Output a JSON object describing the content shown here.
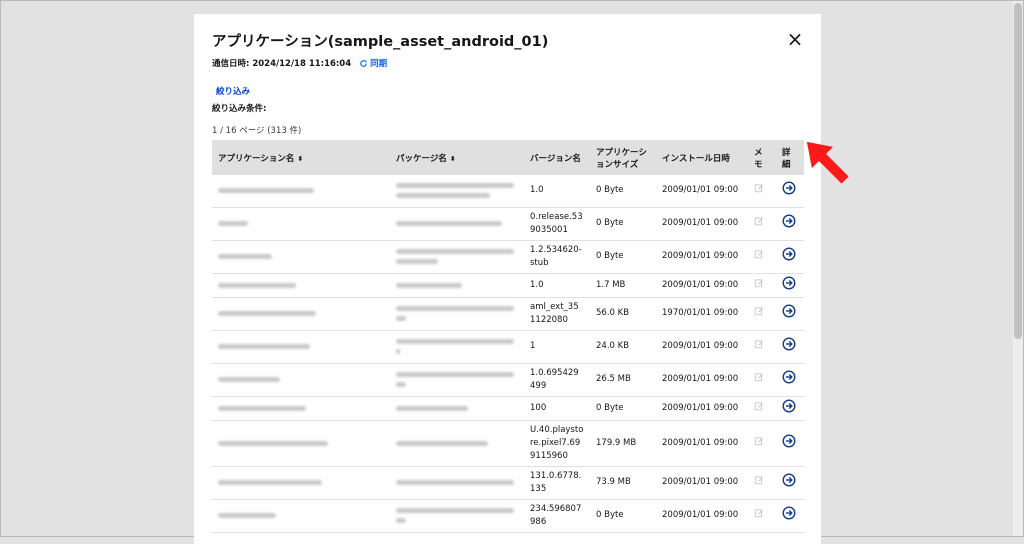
{
  "modal": {
    "title": "アプリケーション(sample_asset_android_01)",
    "close_label": "×",
    "comm_label": "通信日時: 2024/12/18 11:16:04",
    "sync_label": "同期",
    "filter_link": "絞り込み",
    "filter_condition": "絞り込み条件:",
    "page_info": "1 / 16 ページ (313 件)"
  },
  "table": {
    "headers": {
      "app_name": "アプリケーション名",
      "package": "パッケージ名",
      "version": "バージョン名",
      "size_1": "アプリケーシ",
      "size_2": "ョンサイズ",
      "install": "インストール日時",
      "memo": "メモ",
      "detail": "詳細"
    },
    "rows": [
      {
        "version": "1.0",
        "size": "0 Byte",
        "install": "2009/01/01 09:00"
      },
      {
        "version": "0.release.539035001",
        "size": "0 Byte",
        "install": "2009/01/01 09:00"
      },
      {
        "version": "1.2.534620-stub",
        "size": "0 Byte",
        "install": "2009/01/01 09:00"
      },
      {
        "version": "1.0",
        "size": "1.7 MB",
        "install": "2009/01/01 09:00"
      },
      {
        "version": "aml_ext_351122080",
        "size": "56.0 KB",
        "install": "1970/01/01 09:00"
      },
      {
        "version": "1",
        "size": "24.0 KB",
        "install": "2009/01/01 09:00"
      },
      {
        "version": "1.0.695429499",
        "size": "26.5 MB",
        "install": "2009/01/01 09:00"
      },
      {
        "version": "100",
        "size": "0 Byte",
        "install": "2009/01/01 09:00"
      },
      {
        "version": "U.40.playstore.pixel7.699115960",
        "size": "179.9 MB",
        "install": "2009/01/01 09:00"
      },
      {
        "version": "131.0.6778.135",
        "size": "73.9 MB",
        "install": "2009/01/01 09:00"
      },
      {
        "version": "234.596807986",
        "size": "0 Byte",
        "install": "2009/01/01 09:00"
      }
    ]
  },
  "colors": {
    "link": "#0043ce",
    "detail_icon": "#0f3a8a",
    "arrow": "#ff1a1a"
  },
  "icons": {
    "sync": "sync-icon",
    "memo": "edit-note-icon",
    "detail": "arrow-right-circle-icon",
    "sort": "sort-icon"
  }
}
